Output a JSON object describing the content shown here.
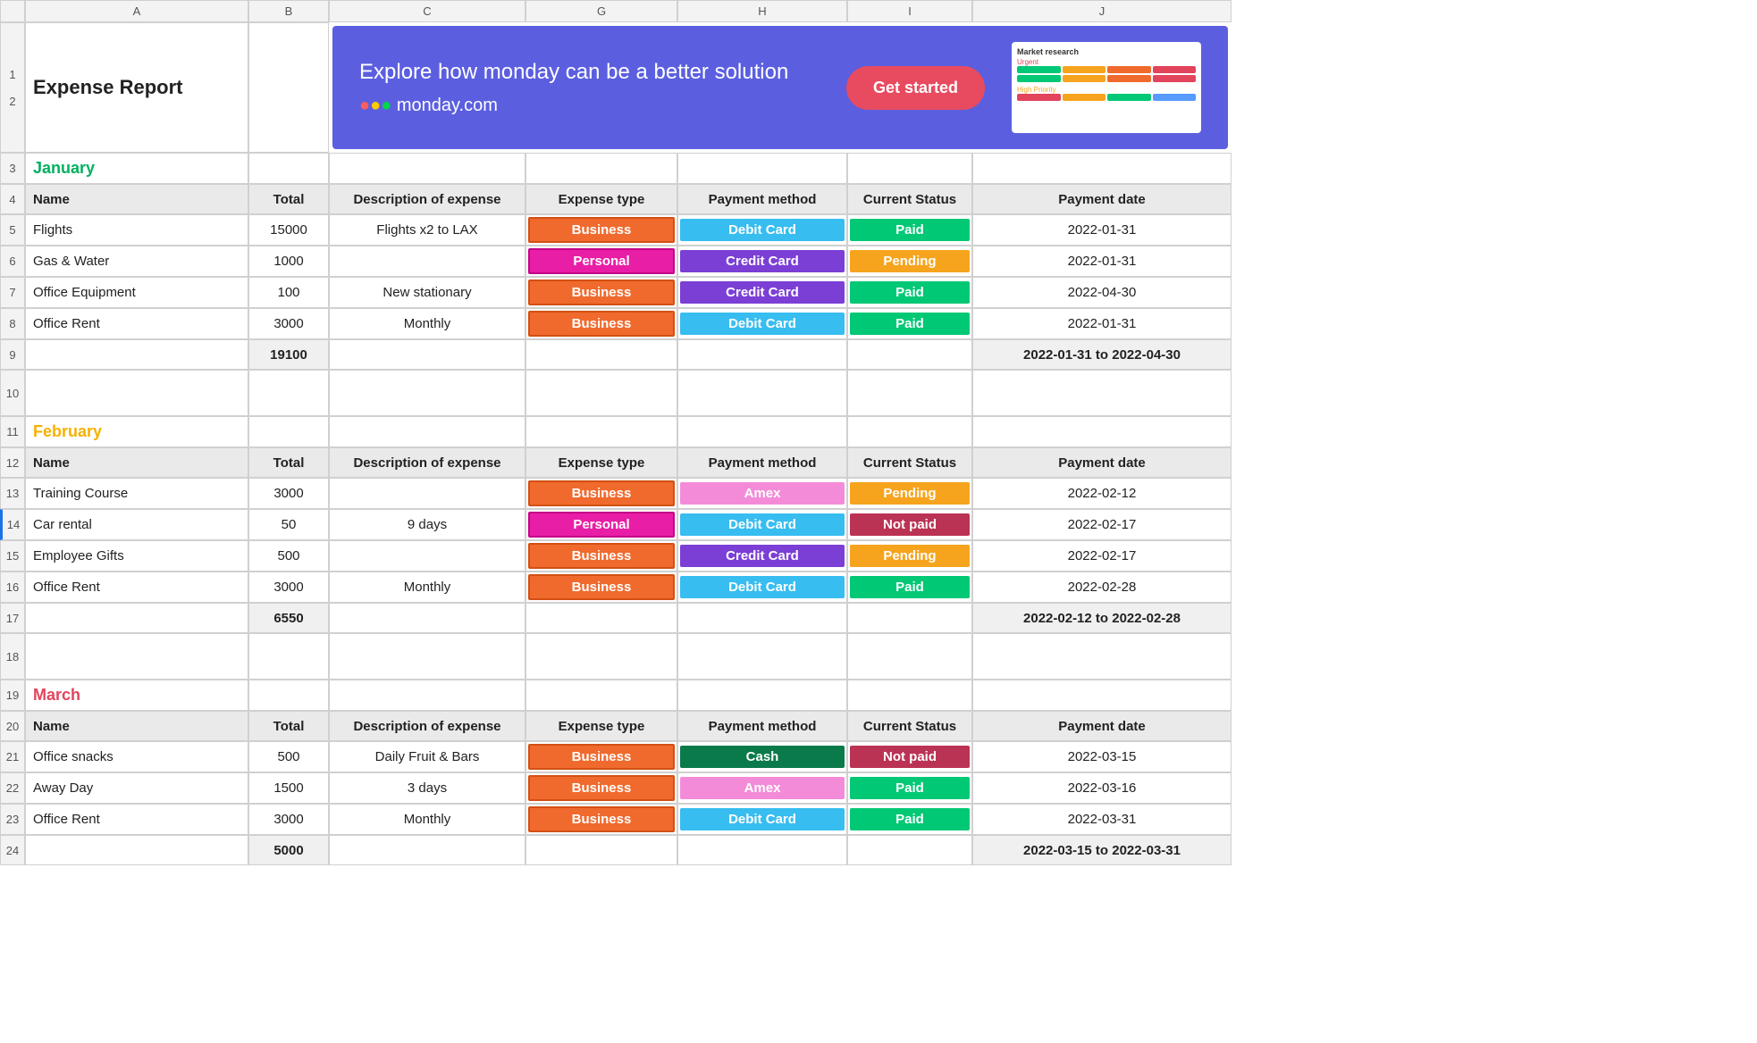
{
  "title": "Expense Report",
  "columnLetters": [
    "A",
    "B",
    "C",
    "G",
    "H",
    "I",
    "J"
  ],
  "rowNumbers": [
    "1",
    "2",
    "3",
    "4",
    "5",
    "6",
    "7",
    "8",
    "9",
    "10",
    "11",
    "12",
    "13",
    "14",
    "15",
    "16",
    "17",
    "18",
    "19",
    "20",
    "21",
    "22",
    "23",
    "24"
  ],
  "banner": {
    "text": "Explore how monday can be a better solution",
    "brand": "monday.com",
    "cta": "Get started",
    "preview_title": "Market research",
    "preview_sub1": "Urgent",
    "preview_sub2": "High Priority"
  },
  "headers": {
    "name": "Name",
    "total": "Total",
    "desc": "Description of expense",
    "type": "Expense type",
    "payment": "Payment method",
    "status": "Current Status",
    "date": "Payment date"
  },
  "months": {
    "jan": "January",
    "feb": "February",
    "mar": "March"
  },
  "jan": {
    "rows": [
      {
        "name": "Flights",
        "total": "15000",
        "desc": "Flights x2 to LAX",
        "type": "Business",
        "payment": "Debit Card",
        "status": "Paid",
        "date": "2022-01-31"
      },
      {
        "name": "Gas & Water",
        "total": "1000",
        "desc": "",
        "type": "Personal",
        "payment": "Credit Card",
        "status": "Pending",
        "date": "2022-01-31"
      },
      {
        "name": "Office Equipment",
        "total": "100",
        "desc": "New stationary",
        "type": "Business",
        "payment": "Credit Card",
        "status": "Paid",
        "date": "2022-04-30"
      },
      {
        "name": "Office Rent",
        "total": "3000",
        "desc": "Monthly",
        "type": "Business",
        "payment": "Debit Card",
        "status": "Paid",
        "date": "2022-01-31"
      }
    ],
    "sum": "19100",
    "range": "2022-01-31 to 2022-04-30"
  },
  "feb": {
    "rows": [
      {
        "name": "Training Course",
        "total": "3000",
        "desc": "",
        "type": "Business",
        "payment": "Amex",
        "status": "Pending",
        "date": "2022-02-12"
      },
      {
        "name": "Car rental",
        "total": "50",
        "desc": "9 days",
        "type": "Personal",
        "payment": "Debit Card",
        "status": "Not paid",
        "date": "2022-02-17"
      },
      {
        "name": "Employee Gifts",
        "total": "500",
        "desc": "",
        "type": "Business",
        "payment": "Credit Card",
        "status": "Pending",
        "date": "2022-02-17"
      },
      {
        "name": "Office Rent",
        "total": "3000",
        "desc": "Monthly",
        "type": "Business",
        "payment": "Debit Card",
        "status": "Paid",
        "date": "2022-02-28"
      }
    ],
    "sum": "6550",
    "range": "2022-02-12 to 2022-02-28"
  },
  "mar": {
    "rows": [
      {
        "name": "Office snacks",
        "total": "500",
        "desc": "Daily Fruit & Bars",
        "type": "Business",
        "payment": "Cash",
        "status": "Not paid",
        "date": "2022-03-15"
      },
      {
        "name": "Away Day",
        "total": "1500",
        "desc": "3 days",
        "type": "Business",
        "payment": "Amex",
        "status": "Paid",
        "date": "2022-03-16"
      },
      {
        "name": "Office Rent",
        "total": "3000",
        "desc": "Monthly",
        "type": "Business",
        "payment": "Debit Card",
        "status": "Paid",
        "date": "2022-03-31"
      }
    ],
    "sum": "5000",
    "range": "2022-03-15 to 2022-03-31"
  }
}
